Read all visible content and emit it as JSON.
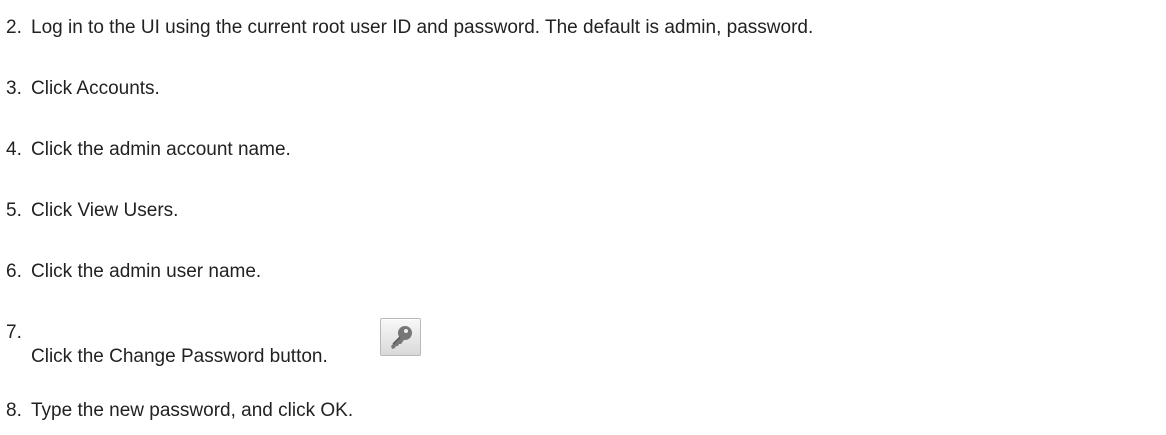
{
  "steps": [
    {
      "num": "2.",
      "text": "Log in to the UI using the current root user ID and password. The default is admin, password."
    },
    {
      "num": "3.",
      "text": "Click Accounts."
    },
    {
      "num": "4.",
      "text": "Click the admin account name."
    },
    {
      "num": "5.",
      "text": "Click View Users."
    },
    {
      "num": "6.",
      "text": "Click the admin user name."
    },
    {
      "num": "7.",
      "text": "Click the Change Password button."
    },
    {
      "num": "8.",
      "text": "Type the new password, and click OK."
    }
  ],
  "icons": {
    "change_password": "key-icon"
  }
}
